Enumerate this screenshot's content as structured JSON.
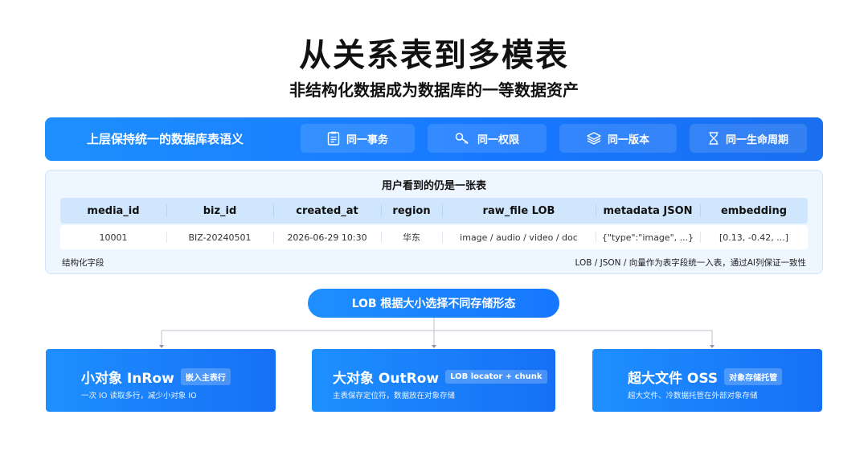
{
  "title": "从关系表到多模表",
  "subtitle": "非结构化数据成为数据库的一等数据资产",
  "top_bar": {
    "label": "上层保持统一的数据库表语义",
    "pills": [
      {
        "label": "同一事务",
        "icon": "document-list-icon"
      },
      {
        "label": "同一权限",
        "icon": "key-icon"
      },
      {
        "label": "同一版本",
        "icon": "layers-icon"
      },
      {
        "label": "同一生命周期",
        "icon": "hourglass-icon"
      }
    ]
  },
  "table_panel": {
    "title": "用户看到的仍是一张表",
    "columns": [
      "media_id",
      "biz_id",
      "created_at",
      "region",
      "raw_file LOB",
      "metadata JSON",
      "embedding"
    ],
    "row": [
      "10001",
      "BIZ-20240501",
      "2026-06-29 10:30",
      "华东",
      "image / audio / video / doc",
      "{\"type\":\"image\", ...}",
      "[0.13, -0.42, ...]"
    ],
    "note_left": "结构化字段",
    "note_right": "LOB / JSON / 向量作为表字段统一入表，通过AI列保证一致性"
  },
  "lob_pill": "LOB 根据大小选择不同存储形态",
  "cards": [
    {
      "title": "小对象 InRow",
      "badge": "嵌入主表行",
      "desc": "一次 IO 读取多行，减少小对象 IO"
    },
    {
      "title": "大对象 OutRow",
      "badge": "LOB locator + chunk",
      "desc": "主表保存定位符，数据放在对象存储"
    },
    {
      "title": "超大文件 OSS",
      "badge": "对象存储托管",
      "desc": "超大文件、冷数据托管在外部对象存储"
    }
  ],
  "colors": {
    "accent": "#1677ff",
    "panel_bg": "#eef6ff",
    "header_bg": "#cfe6fd"
  }
}
